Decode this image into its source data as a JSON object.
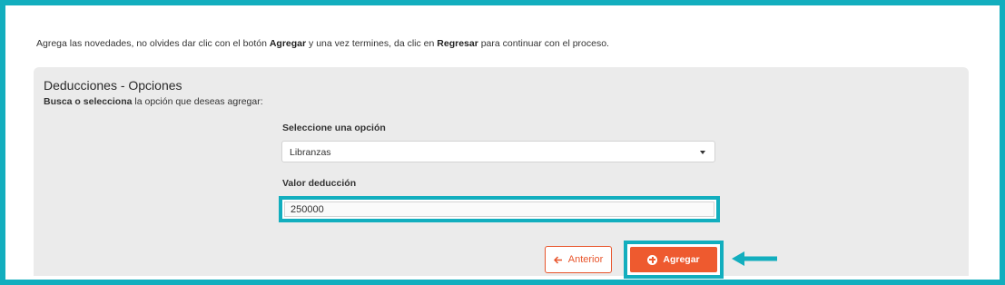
{
  "intro": {
    "part1": "Agrega las novedades, no olvides dar clic con el botón ",
    "bold1": "Agregar",
    "part2": " y una vez termines, da clic en ",
    "bold2": "Regresar",
    "part3": " para continuar con el proceso."
  },
  "panel": {
    "title": "Deducciones - Opciones",
    "subtitle_bold": "Busca o selecciona",
    "subtitle_rest": " la opción que deseas agregar:"
  },
  "form": {
    "select_label": "Seleccione una opción",
    "select_value": "Libranzas",
    "value_label": "Valor deducción",
    "value_input": "250000"
  },
  "buttons": {
    "prev_label": "Anterior",
    "add_label": "Agregar"
  },
  "colors": {
    "highlight": "#12aebe",
    "accent": "#ee5a2f"
  },
  "icons": {
    "prev": "arrow-left-icon",
    "add": "plus-circle-icon",
    "select": "caret-down-icon",
    "pointer": "pointer-arrow-icon"
  }
}
